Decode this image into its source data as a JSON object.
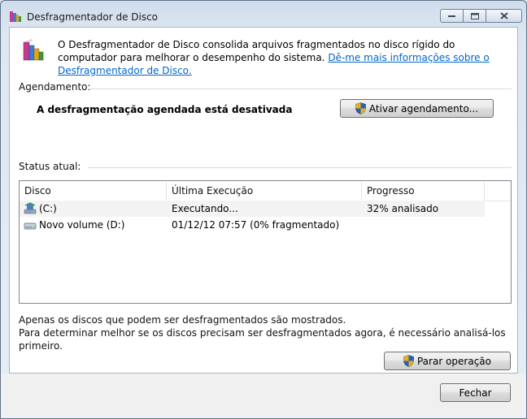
{
  "window": {
    "title": "Desfragmentador de Disco"
  },
  "header": {
    "description": "O Desfragmentador de Disco consolida arquivos fragmentados no disco rígido do computador para melhorar o desempenho do sistema.",
    "link": "Dê-me mais informações sobre o Desfragmentador de Disco."
  },
  "schedule": {
    "label": "Agendamento:",
    "status": "A desfragmentação agendada está desativada",
    "button": "Ativar agendamento..."
  },
  "current": {
    "label": "Status atual:",
    "columns": [
      "Disco",
      "Última Execução",
      "Progresso"
    ],
    "rows": [
      {
        "disk": "(C:)",
        "last_run": "Executando...",
        "progress": "32% analisado",
        "icon": "running-drive-icon"
      },
      {
        "disk": "Novo volume (D:)",
        "last_run": "01/12/12 07:57 (0% fragmentado)",
        "progress": "",
        "icon": "hard-drive-icon"
      }
    ]
  },
  "notes": {
    "line1": "Apenas os discos que podem ser desfragmentados são mostrados.",
    "line2": "Para determinar melhor se os discos precisam ser desfragmentados agora, é necessário analisá-los primeiro."
  },
  "actions": {
    "stop": "Parar operação",
    "close": "Fechar"
  }
}
